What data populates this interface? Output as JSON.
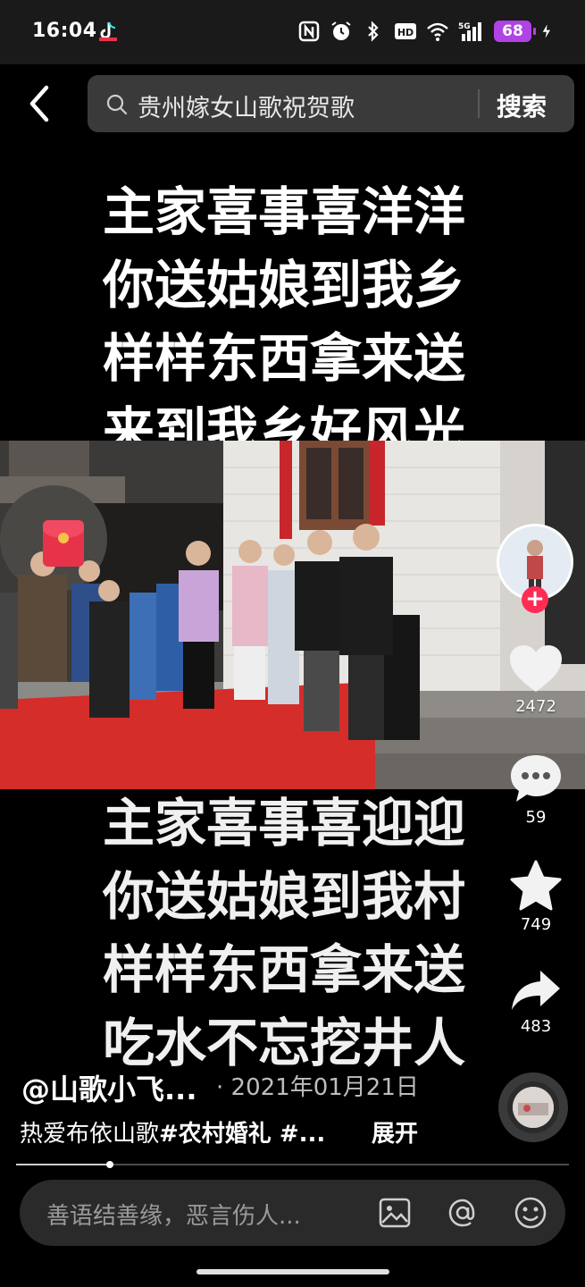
{
  "status_bar": {
    "time": "16:04",
    "battery": "68",
    "icons": [
      "tiktok-notification-icon",
      "nfc-icon",
      "alarm-icon",
      "bluetooth-icon",
      "hd-icon",
      "wifi-icon",
      "5g-signal-icon",
      "charging-icon"
    ]
  },
  "search": {
    "query": "贵州嫁女山歌祝贺歌",
    "button_label": "搜索"
  },
  "video": {
    "lyrics_top": [
      "主家喜事喜洋洋",
      "你送姑娘到我乡",
      "样样东西拿来送",
      "来到我乡好风光"
    ],
    "lyrics_bottom": [
      "主家喜事喜迎迎",
      "你送姑娘到我村",
      "样样东西拿来送",
      "吃水不忘挖井人"
    ],
    "progress": 0.17
  },
  "actions": {
    "likes": "2472",
    "comments": "59",
    "favorites": "749",
    "shares": "483"
  },
  "post": {
    "author": "@山歌小飞...",
    "date": "· 2021年01月21日",
    "caption_text": "热爱布依山歌",
    "caption_tags": "#农村婚礼 #...",
    "expand_label": "展开"
  },
  "comment_bar": {
    "placeholder": "善语结善缘，恶言伤人..."
  },
  "colors": {
    "accent_red": "#fe2c55",
    "battery": "#b043e6",
    "background": "#000000"
  }
}
